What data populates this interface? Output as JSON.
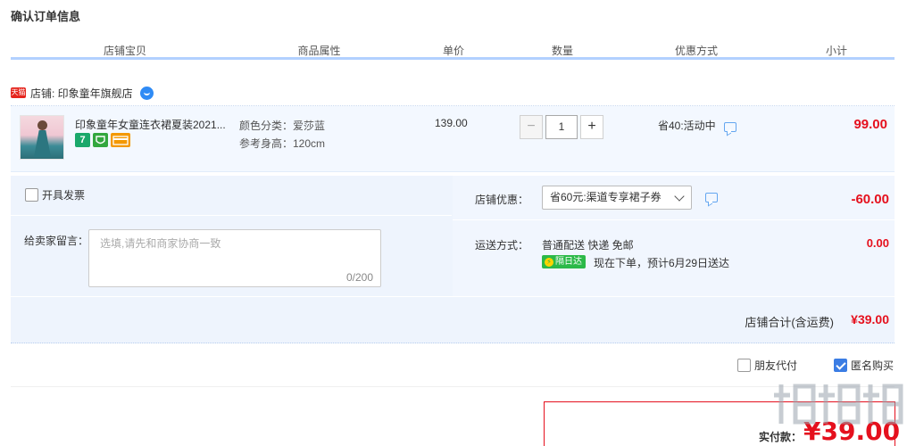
{
  "page": {
    "title": "确认订单信息"
  },
  "table_headers": [
    "店铺宝贝",
    "商品属性",
    "单价",
    "数量",
    "优惠方式",
    "小计"
  ],
  "shop": {
    "badge": "天猫",
    "label": "店铺: 印象童年旗舰店"
  },
  "item": {
    "title": "印象童年女童连衣裙夏装2021...",
    "icons": [
      "seven-day-return-icon",
      "shield-icon",
      "card-icon"
    ],
    "icon_text": {
      "seven": "7"
    },
    "attr_color": "颜色分类：爱莎蓝",
    "attr_height": "参考身高：120cm",
    "unit_price": "139.00",
    "quantity": "1",
    "minus": "−",
    "plus": "+",
    "promo": "省40:活动中",
    "subtotal": "99.00"
  },
  "options": {
    "invoice_label": "开具发票",
    "message_label": "给卖家留言：",
    "message_placeholder": "选填,请先和商家协商一致",
    "message_count": "0/200",
    "shop_discount_label": "店铺优惠：",
    "coupon_selected": "省60元:渠道专享裙子券",
    "discount_amount": "-60.00",
    "shipping_label": "运送方式：",
    "shipping_method": "普通配送 快递 免邮",
    "shipping_badge": "隔日达",
    "shipping_eta": "现在下单，预计6月29日送达",
    "shipping_fee": "0.00"
  },
  "shop_total": {
    "label": "店铺合计(含运费)",
    "value": "¥39.00"
  },
  "checkout": {
    "friend_pay": "朋友代付",
    "friend_pay_checked": false,
    "anonymous": "匿名购买",
    "anonymous_checked": true,
    "pay_label": "实付款：",
    "pay_value": "¥39.00"
  },
  "colors": {
    "accent_red": "#e5101d",
    "header_line": "#b2d1ff",
    "panel_bg": "#eef4fd"
  }
}
